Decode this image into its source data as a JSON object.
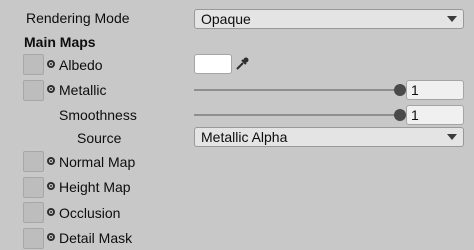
{
  "rendering_mode": {
    "label": "Rendering Mode",
    "value": "Opaque"
  },
  "main_maps": {
    "title": "Main Maps",
    "albedo": {
      "label": "Albedo",
      "color": "#ffffff"
    },
    "metallic": {
      "label": "Metallic",
      "value": "1",
      "slider_fraction": 1.0
    },
    "smoothness": {
      "label": "Smoothness",
      "value": "1",
      "slider_fraction": 1.0
    },
    "source": {
      "label": "Source",
      "value": "Metallic Alpha"
    },
    "normal_map": {
      "label": "Normal Map"
    },
    "height_map": {
      "label": "Height Map"
    },
    "occlusion": {
      "label": "Occlusion"
    },
    "detail_mask": {
      "label": "Detail Mask"
    }
  },
  "icons": {
    "texture_picker": "object-picker-icon",
    "eyedropper": "eyedropper-icon",
    "dropdown": "chevron-down-icon"
  },
  "colors": {
    "background": "#c8c8c8",
    "slider_thumb": "#4a4a4a"
  }
}
